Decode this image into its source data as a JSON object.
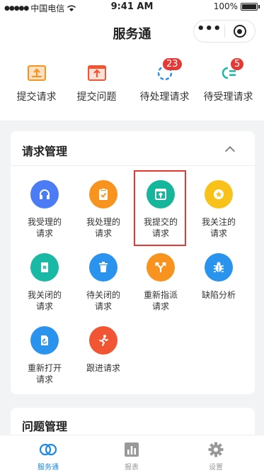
{
  "status": {
    "carrier": "中国电信",
    "time": "9:41 AM",
    "battery": "100%"
  },
  "nav": {
    "title": "服务通",
    "more": "•••"
  },
  "quick": [
    {
      "label": "提交请求",
      "icon": "submit-request-icon"
    },
    {
      "label": "提交问题",
      "icon": "submit-issue-icon"
    },
    {
      "label": "待处理请求",
      "icon": "pending-process-icon",
      "badge": "23"
    },
    {
      "label": "待受理请求",
      "icon": "pending-accept-icon",
      "badge": "5"
    }
  ],
  "request_mgmt": {
    "title": "请求管理",
    "items": [
      {
        "l1": "我受理的",
        "l2": "请求",
        "icon": "headset-icon",
        "color": "#4b7bf5"
      },
      {
        "l1": "我处理的",
        "l2": "请求",
        "icon": "clipboard-check-icon",
        "color": "#f7931e"
      },
      {
        "l1": "我提交的",
        "l2": "请求",
        "icon": "upload-box-icon",
        "color": "#16b69c"
      },
      {
        "l1": "我关注的",
        "l2": "请求",
        "icon": "star-icon",
        "color": "#f8c21b"
      },
      {
        "l1": "我关闭的",
        "l2": "请求",
        "icon": "close-doc-icon",
        "color": "#19b9a5"
      },
      {
        "l1": "待关闭的",
        "l2": "请求",
        "icon": "trash-icon",
        "color": "#2a93ee"
      },
      {
        "l1": "重新指派",
        "l2": "请求",
        "icon": "fork-icon",
        "color": "#f7931e"
      },
      {
        "l1": "缺陷分析",
        "l2": "",
        "icon": "bug-icon",
        "color": "#2a93ee"
      },
      {
        "l1": "重新打开",
        "l2": "请求",
        "icon": "reopen-doc-icon",
        "color": "#2a93ee"
      },
      {
        "l1": "跟进请求",
        "l2": "",
        "icon": "running-icon",
        "color": "#f25533"
      }
    ]
  },
  "issue_mgmt": {
    "title": "问题管理"
  },
  "tabbar": [
    {
      "label": "服务通",
      "icon": "home-icon"
    },
    {
      "label": "报表",
      "icon": "chart-icon"
    },
    {
      "label": "设置",
      "icon": "gear-icon"
    }
  ],
  "colors": {
    "accent": "#1e88e5",
    "orange": "#f7931e",
    "red": "#e53935"
  }
}
